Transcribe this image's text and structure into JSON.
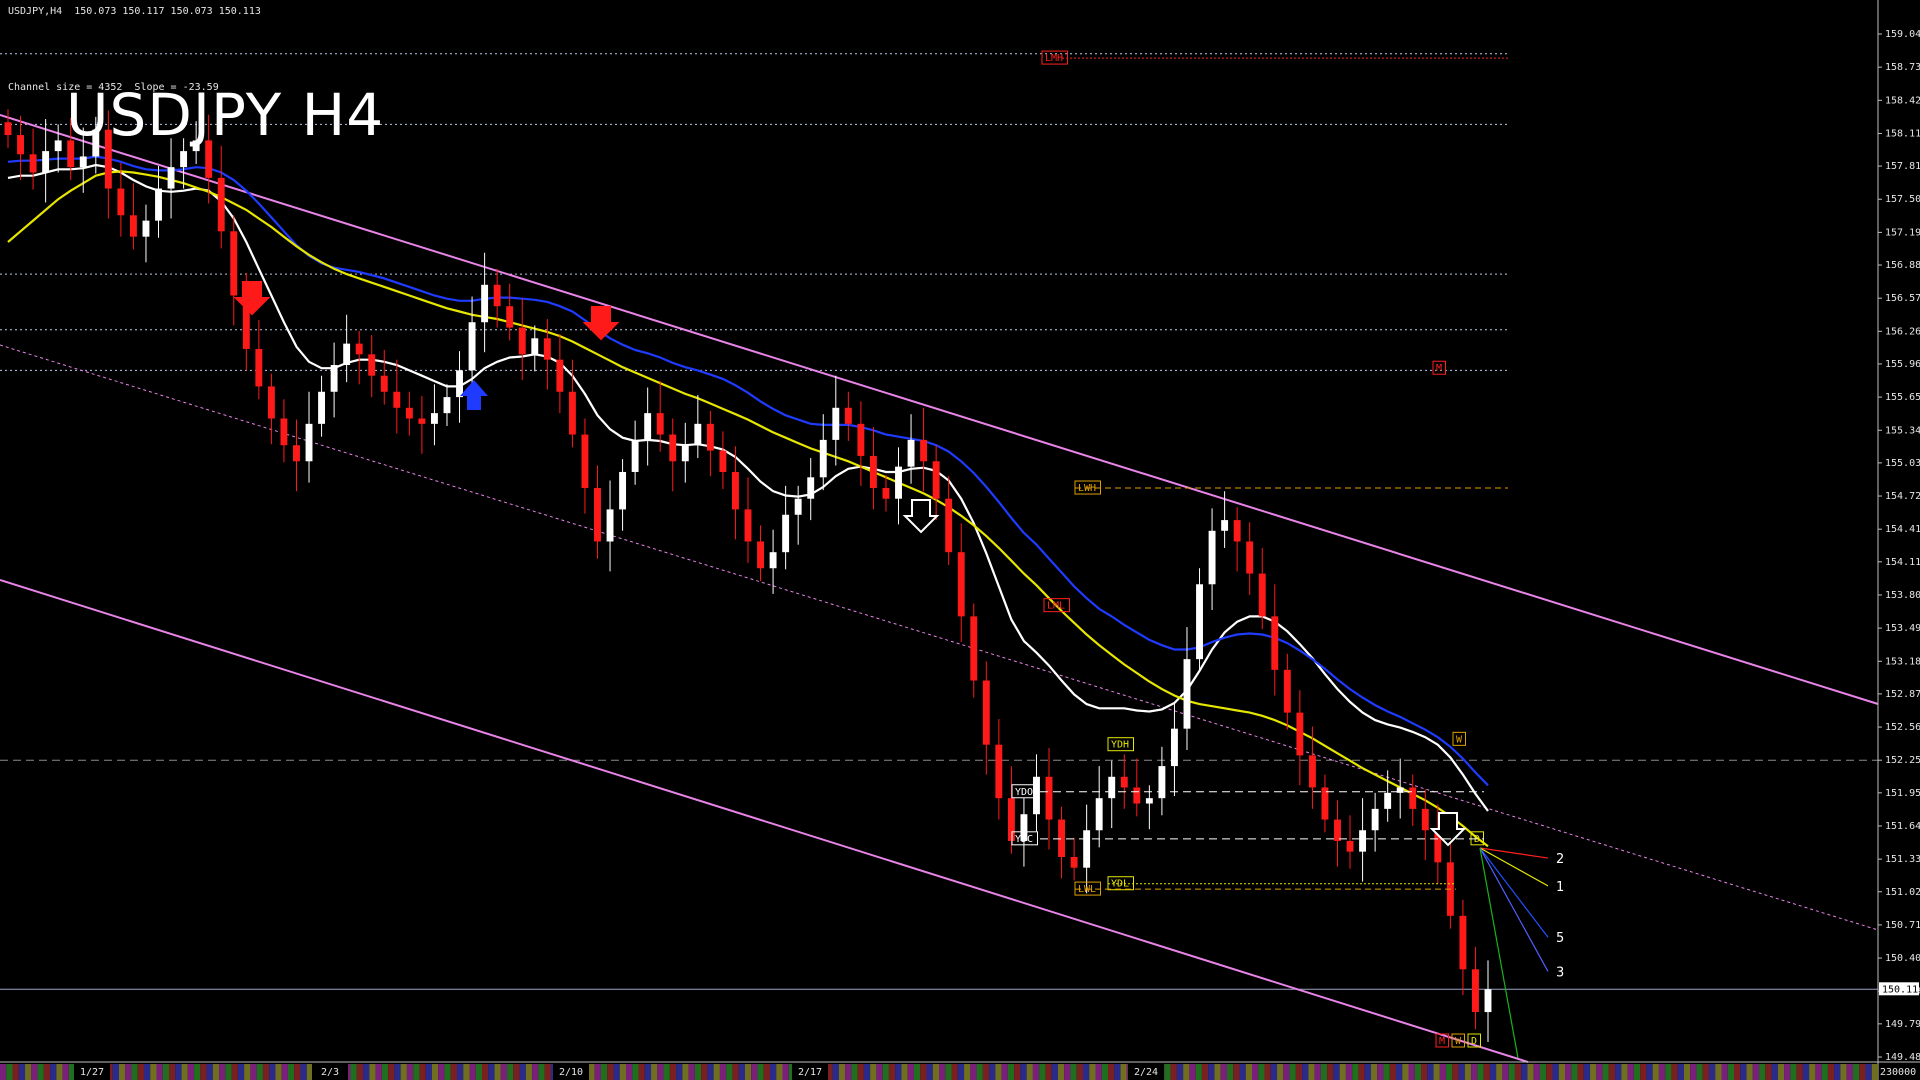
{
  "header": {
    "info": "USDJPY,H4  150.073 150.117 150.073 150.113",
    "channel": "Channel size = 4352  Slope = -23.59",
    "title": "USDJPY H4"
  },
  "colors": {
    "background": "#000000",
    "bull_candle": "#ffffff",
    "bear_candle": "#ff1a1a",
    "channel": "#e884e8",
    "ma_blue": "#1f3bff",
    "ma_yellow": "#e6e600",
    "ma_white": "#ffffff",
    "green_line": "#19b319",
    "cloud": "#c06000"
  },
  "chart_data": {
    "type": "candlestick",
    "symbol": "USDJPY",
    "timeframe": "H4",
    "ylim": [
      149.48,
      159.045
    ],
    "yticks": [
      "159.045",
      "158.735",
      "158.425",
      "158.115",
      "157.810",
      "157.500",
      "157.190",
      "156.885",
      "156.575",
      "156.265",
      "155.960",
      "155.650",
      "155.340",
      "155.035",
      "154.725",
      "154.415",
      "154.110",
      "153.800",
      "153.490",
      "153.180",
      "152.875",
      "152.565",
      "152.255",
      "151.950",
      "151.640",
      "151.330",
      "151.025",
      "150.715",
      "150.405",
      "150.095",
      "149.790",
      "149.480"
    ],
    "xticks": [
      "1/27",
      "2/3",
      "2/10",
      "2/17",
      "2/24"
    ],
    "current_price": "150.113",
    "current_price_value": 150.113,
    "reference_price_value": 152.255,
    "horizontal_dotted_levels": [
      158.86,
      158.2,
      156.8,
      156.28,
      155.9
    ],
    "price_tags": [
      {
        "label": "LMH",
        "price": 158.82,
        "color": "#ff2020"
      },
      {
        "label": "M",
        "price": 155.92,
        "color": "#ff2020"
      },
      {
        "label": "LWH",
        "price": 154.8,
        "color": "#e0a000"
      },
      {
        "label": "LML",
        "price": 153.7,
        "color": "#ff2020"
      },
      {
        "label": "YDH",
        "price": 152.4,
        "color": "#e6e600"
      },
      {
        "label": "YDO",
        "price": 151.96,
        "color": "#ffffff"
      },
      {
        "label": "YDC",
        "price": 151.52,
        "color": "#ffffff"
      },
      {
        "label": "LWL",
        "price": 151.05,
        "color": "#e0a000"
      },
      {
        "label": "YDL",
        "price": 151.1,
        "color": "#e6e600"
      },
      {
        "label": "W",
        "price": 152.45,
        "color": "#e0a000"
      },
      {
        "label": "D",
        "price": 151.52,
        "color": "#e6e600"
      },
      {
        "label": "M",
        "price": 149.6,
        "color": "#ff2020"
      },
      {
        "label": "W",
        "price": 149.6,
        "color": "#e0a000"
      },
      {
        "label": "D",
        "price": 149.6,
        "color": "#e6e600"
      }
    ],
    "projection_labels": [
      {
        "label": "2",
        "price": 151.34
      },
      {
        "label": "1",
        "price": 151.08
      },
      {
        "label": "5",
        "price": 150.6
      },
      {
        "label": "3",
        "price": 150.28
      }
    ],
    "volume_label": "230000",
    "closes": [
      158.1,
      157.92,
      157.75,
      157.95,
      158.05,
      157.8,
      157.9,
      158.15,
      157.6,
      157.35,
      157.15,
      157.3,
      157.6,
      157.8,
      157.95,
      158.05,
      157.7,
      157.2,
      156.6,
      156.1,
      155.75,
      155.45,
      155.2,
      155.05,
      155.4,
      155.7,
      155.95,
      156.15,
      156.05,
      155.85,
      155.7,
      155.55,
      155.45,
      155.4,
      155.5,
      155.65,
      155.9,
      156.35,
      156.7,
      156.5,
      156.3,
      156.05,
      156.2,
      156.0,
      155.7,
      155.3,
      154.8,
      154.3,
      154.6,
      154.95,
      155.25,
      155.5,
      155.3,
      155.05,
      155.2,
      155.4,
      155.15,
      154.95,
      154.6,
      154.3,
      154.05,
      154.2,
      154.55,
      154.7,
      154.9,
      155.25,
      155.55,
      155.4,
      155.1,
      154.8,
      154.7,
      155.0,
      155.25,
      155.05,
      154.7,
      154.2,
      153.6,
      153.0,
      152.4,
      151.9,
      151.5,
      151.75,
      152.1,
      151.7,
      151.35,
      151.25,
      151.6,
      151.9,
      152.1,
      152.0,
      151.85,
      151.9,
      152.2,
      152.55,
      153.2,
      153.9,
      154.4,
      154.5,
      154.3,
      154.0,
      153.6,
      153.1,
      152.7,
      152.3,
      152.0,
      151.7,
      151.5,
      151.4,
      151.6,
      151.8,
      151.95,
      152.0,
      151.8,
      151.6,
      151.3,
      150.8,
      150.3,
      149.9,
      150.113
    ],
    "series": [
      {
        "name": "",
        "values": [
          157.7,
          157.72,
          157.72,
          157.75,
          157.78,
          157.78,
          157.79,
          157.82,
          157.8,
          157.75,
          157.68,
          157.62,
          157.58,
          157.57,
          157.58,
          157.6,
          157.58,
          157.48,
          157.32,
          157.1,
          156.85,
          156.6,
          156.35,
          156.12,
          155.98,
          155.92,
          155.92,
          155.97,
          156.0,
          156.0,
          155.98,
          155.95,
          155.9,
          155.85,
          155.8,
          155.75,
          155.75,
          155.82,
          155.92,
          155.98,
          156.02,
          156.03,
          156.05,
          156.03,
          155.97,
          155.85,
          155.68,
          155.48,
          155.35,
          155.27,
          155.24,
          155.25,
          155.24,
          155.21,
          155.2,
          155.21,
          155.19,
          155.16,
          155.09,
          154.98,
          154.86,
          154.77,
          154.73,
          154.72,
          154.74,
          154.81,
          154.91,
          154.98,
          155.0,
          154.98,
          154.95,
          154.95,
          154.98,
          154.99,
          154.96,
          154.87,
          154.7,
          154.47,
          154.19,
          153.88,
          153.57,
          153.37,
          153.26,
          153.14,
          153.0,
          152.87,
          152.78,
          152.74,
          152.74,
          152.74,
          152.72,
          152.71,
          152.73,
          152.79,
          152.91,
          153.09,
          153.29,
          153.45,
          153.55,
          153.6,
          153.6,
          153.55,
          153.46,
          153.34,
          153.21,
          153.06,
          152.92,
          152.8,
          152.7,
          152.63,
          152.59,
          152.56,
          152.52,
          152.47,
          152.4,
          152.28,
          152.12,
          151.94,
          151.78
        ]
      },
      {
        "name": "",
        "values": [
          157.85,
          157.86,
          157.86,
          157.87,
          157.88,
          157.88,
          157.88,
          157.9,
          157.88,
          157.85,
          157.81,
          157.78,
          157.77,
          157.77,
          157.78,
          157.8,
          157.79,
          157.75,
          157.68,
          157.58,
          157.46,
          157.33,
          157.2,
          157.07,
          156.97,
          156.9,
          156.86,
          156.84,
          156.82,
          156.79,
          156.76,
          156.72,
          156.68,
          156.64,
          156.6,
          156.57,
          156.55,
          156.55,
          156.57,
          156.58,
          156.58,
          156.57,
          156.56,
          156.54,
          156.5,
          156.45,
          156.37,
          156.28,
          156.2,
          156.14,
          156.09,
          156.06,
          156.02,
          155.97,
          155.93,
          155.9,
          155.86,
          155.82,
          155.76,
          155.69,
          155.61,
          155.54,
          155.48,
          155.44,
          155.4,
          155.39,
          155.39,
          155.39,
          155.37,
          155.34,
          155.3,
          155.28,
          155.26,
          155.24,
          155.2,
          155.14,
          155.05,
          154.94,
          154.81,
          154.67,
          154.52,
          154.38,
          154.27,
          154.14,
          154.01,
          153.88,
          153.77,
          153.67,
          153.6,
          153.52,
          153.45,
          153.38,
          153.33,
          153.29,
          153.29,
          153.31,
          153.36,
          153.4,
          153.43,
          153.44,
          153.43,
          153.4,
          153.35,
          153.28,
          153.2,
          153.11,
          153.01,
          152.92,
          152.84,
          152.77,
          152.71,
          152.66,
          152.6,
          152.54,
          152.47,
          152.38,
          152.27,
          152.14,
          152.02
        ]
      },
      {
        "name": "",
        "values": [
          157.1,
          157.2,
          157.3,
          157.4,
          157.5,
          157.58,
          157.65,
          157.72,
          157.75,
          157.76,
          157.75,
          157.73,
          157.71,
          157.68,
          157.65,
          157.61,
          157.57,
          157.52,
          157.46,
          157.4,
          157.32,
          157.24,
          157.15,
          157.06,
          156.98,
          156.91,
          156.85,
          156.8,
          156.76,
          156.72,
          156.68,
          156.64,
          156.6,
          156.56,
          156.52,
          156.48,
          156.45,
          156.42,
          156.4,
          156.38,
          156.35,
          156.32,
          156.29,
          156.26,
          156.22,
          156.17,
          156.11,
          156.05,
          155.99,
          155.93,
          155.88,
          155.83,
          155.78,
          155.73,
          155.68,
          155.64,
          155.59,
          155.54,
          155.49,
          155.44,
          155.38,
          155.32,
          155.27,
          155.22,
          155.17,
          155.13,
          155.09,
          155.05,
          155.0,
          154.95,
          154.9,
          154.85,
          154.8,
          154.75,
          154.69,
          154.62,
          154.54,
          154.45,
          154.35,
          154.24,
          154.12,
          154.0,
          153.89,
          153.77,
          153.65,
          153.54,
          153.43,
          153.33,
          153.24,
          153.15,
          153.07,
          152.99,
          152.92,
          152.86,
          152.81,
          152.78,
          152.76,
          152.74,
          152.72,
          152.7,
          152.67,
          152.63,
          152.58,
          152.52,
          152.46,
          152.39,
          152.32,
          152.25,
          152.18,
          152.12,
          152.06,
          152.0,
          151.94,
          151.88,
          151.81,
          151.73,
          151.64,
          151.54,
          151.45
        ]
      }
    ]
  }
}
